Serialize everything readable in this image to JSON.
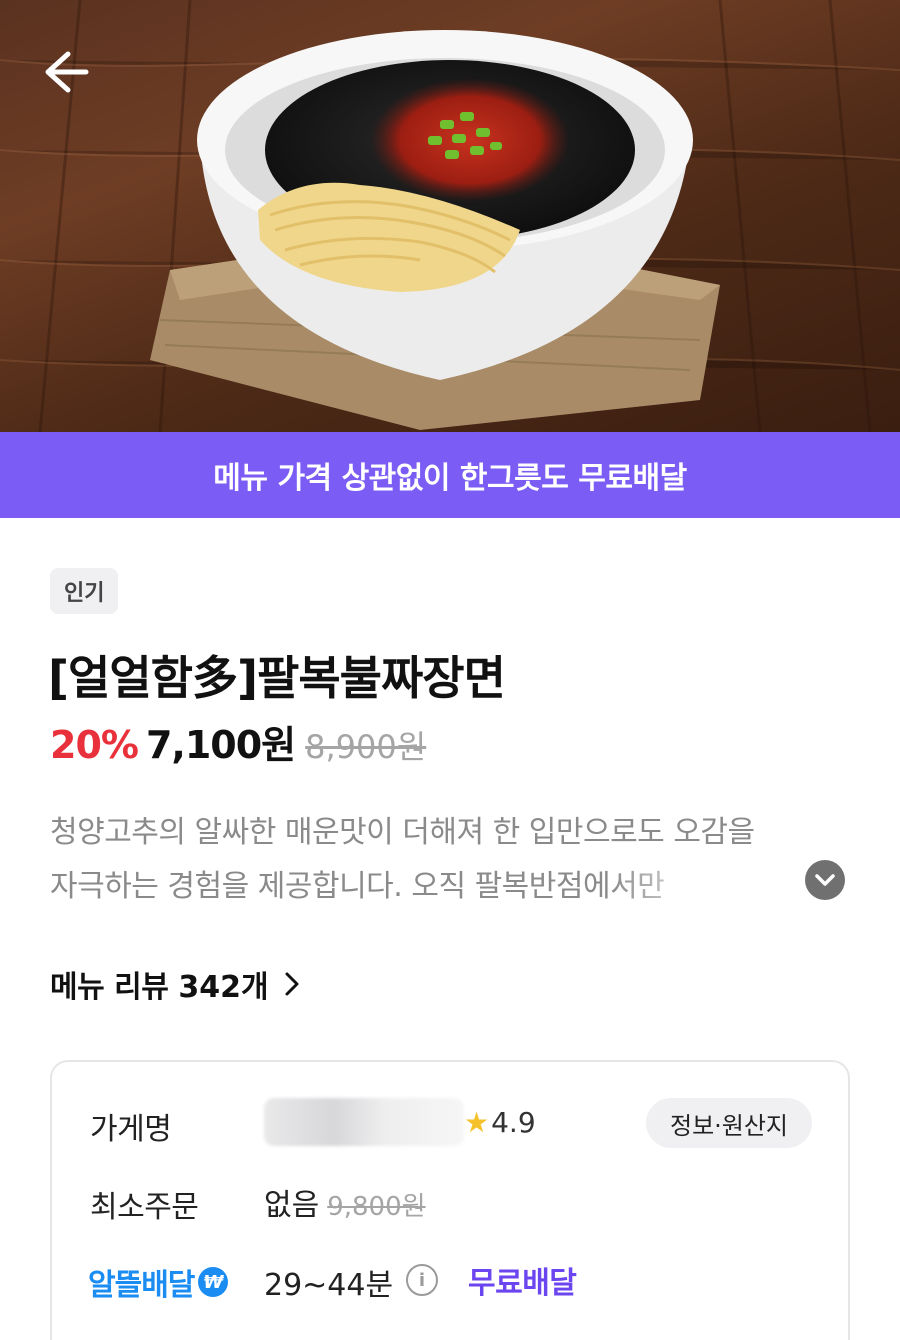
{
  "hero": {
    "image": "jjajangmyeon-bowl-photo"
  },
  "header": {
    "back_icon": "arrow-left-icon"
  },
  "banner": {
    "text": "메뉴 가격 상관없이 한그릇도 무료배달"
  },
  "menu": {
    "tag": "인기",
    "title": "[얼얼함多]팔복불짜장면",
    "discount": "20%",
    "price": "7,100원",
    "original_price": "8,900원",
    "description_line1": "청양고추의 알싸한 매운맛이 더해져 한 입만으로도 오감을",
    "description_line2": "자극하는 경험을 제공합니다. 오직 팔복반점에서만",
    "expand_icon": "chevron-down-icon"
  },
  "review": {
    "label": "메뉴 리뷰",
    "count": "342개",
    "chevron_icon": "chevron-right-icon"
  },
  "store": {
    "name_label": "가게명",
    "rating": "4.9",
    "info_button": "정보·원산지",
    "min_order_label": "최소주문",
    "min_order_value": "없음",
    "min_order_original": "9,800원",
    "delivery_type": "알뜰배달",
    "delivery_time": "29~44분",
    "free_delivery": "무료배달"
  },
  "colors": {
    "banner": "#7b5cf5",
    "discount": "#e8313a",
    "delivery_badge": "#1a8cf2",
    "free_delivery": "#6b45f0"
  }
}
